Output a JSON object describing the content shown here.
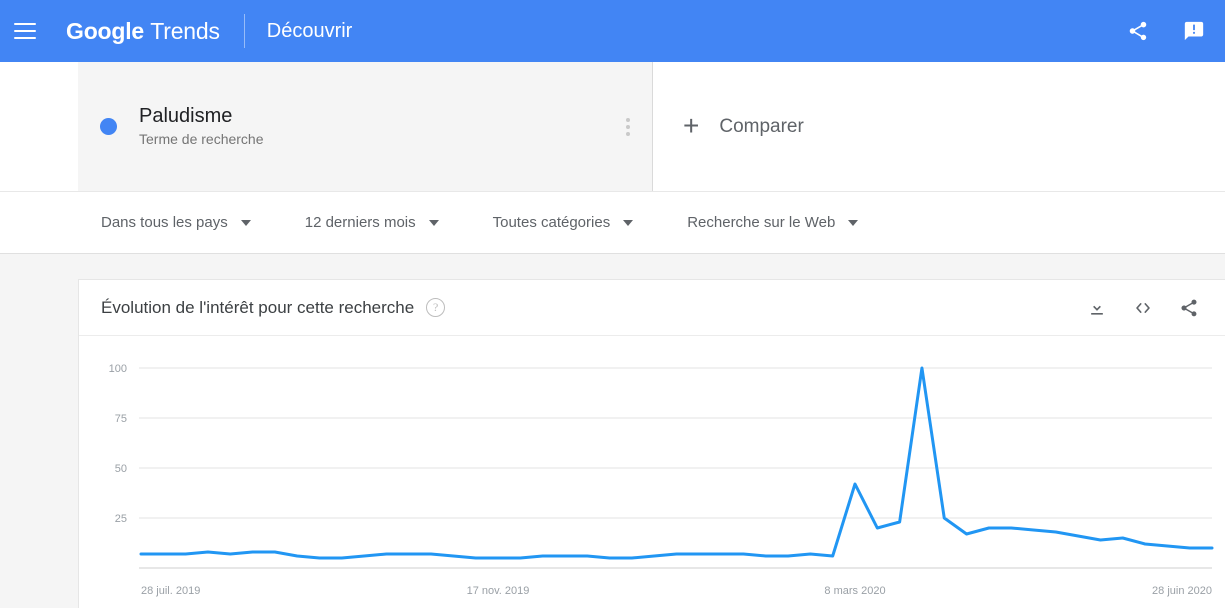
{
  "appbar": {
    "menu_icon": "hamburger-icon",
    "brand_bold": "Google",
    "brand_light": "Trends",
    "section": "Découvrir",
    "share_icon": "share-icon",
    "feedback_icon": "feedback-icon",
    "background_color": "#4285f4"
  },
  "terms": {
    "card": {
      "title": "Paludisme",
      "subtitle": "Terme de recherche",
      "dot_color": "#4285f4",
      "menu_icon": "more-vertical-icon"
    },
    "compare": {
      "plus": "+",
      "label": "Comparer"
    }
  },
  "filters": [
    {
      "label": "Dans tous les pays"
    },
    {
      "label": "12 derniers mois"
    },
    {
      "label": "Toutes catégories"
    },
    {
      "label": "Recherche sur le Web"
    }
  ],
  "chart_card": {
    "title": "Évolution de l'intérêt pour cette recherche",
    "help_glyph": "?",
    "tools": [
      {
        "name": "download-icon"
      },
      {
        "name": "embed-icon",
        "glyph": "<>"
      },
      {
        "name": "share-icon"
      }
    ]
  },
  "chart_data": {
    "type": "line",
    "title": "Évolution de l'intérêt pour cette recherche",
    "subtitle": "",
    "xlabel": "",
    "ylabel": "",
    "series_name": "Paludisme",
    "line_color": "#2196f3",
    "grid": true,
    "legend_position": "none",
    "ylim": [
      0,
      100
    ],
    "y_ticks": [
      100,
      75,
      50,
      25
    ],
    "x_ticks": [
      "28 juil. 2019",
      "17 nov. 2019",
      "8 mars 2020",
      "28 juin 2020"
    ],
    "x_tick_indices": [
      0,
      16,
      32,
      48
    ],
    "x": [
      "28 juil. 2019",
      "4 août 2019",
      "11 août 2019",
      "18 août 2019",
      "25 août 2019",
      "1 sept. 2019",
      "8 sept. 2019",
      "15 sept. 2019",
      "22 sept. 2019",
      "29 sept. 2019",
      "6 oct. 2019",
      "13 oct. 2019",
      "20 oct. 2019",
      "27 oct. 2019",
      "3 nov. 2019",
      "10 nov. 2019",
      "17 nov. 2019",
      "24 nov. 2019",
      "1 déc. 2019",
      "8 déc. 2019",
      "15 déc. 2019",
      "22 déc. 2019",
      "29 déc. 2019",
      "5 janv. 2020",
      "12 janv. 2020",
      "19 janv. 2020",
      "26 janv. 2020",
      "2 févr. 2020",
      "9 févr. 2020",
      "16 févr. 2020",
      "23 févr. 2020",
      "1 mars 2020",
      "8 mars 2020",
      "15 mars 2020",
      "22 mars 2020",
      "29 mars 2020",
      "5 avr. 2020",
      "12 avr. 2020",
      "19 avr. 2020",
      "26 avr. 2020",
      "3 mai 2020",
      "10 mai 2020",
      "17 mai 2020",
      "24 mai 2020",
      "31 mai 2020",
      "7 juin 2020",
      "14 juin 2020",
      "21 juin 2020",
      "28 juin 2020"
    ],
    "values": [
      7,
      7,
      7,
      8,
      7,
      8,
      8,
      6,
      5,
      5,
      6,
      7,
      7,
      7,
      6,
      5,
      5,
      5,
      6,
      6,
      6,
      5,
      5,
      6,
      7,
      7,
      7,
      7,
      6,
      6,
      7,
      6,
      42,
      20,
      23,
      100,
      25,
      17,
      20,
      20,
      19,
      18,
      16,
      14,
      15,
      12,
      11,
      10,
      10
    ]
  }
}
